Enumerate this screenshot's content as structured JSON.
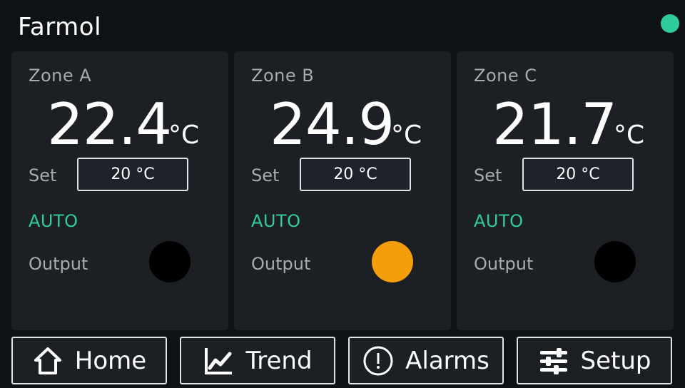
{
  "header": {
    "title": "Farmol",
    "status_color": "#2ecc9a"
  },
  "colors": {
    "accent": "#2ecc9a",
    "output_on": "#f59e0b",
    "output_off": "#000000"
  },
  "zones": [
    {
      "name": "Zone A",
      "temperature": "22.4",
      "unit": "°C",
      "set_label": "Set",
      "setpoint": "20 °C",
      "mode": "AUTO",
      "output_label": "Output",
      "output_on": false
    },
    {
      "name": "Zone B",
      "temperature": "24.9",
      "unit": "°C",
      "set_label": "Set",
      "setpoint": "20 °C",
      "mode": "AUTO",
      "output_label": "Output",
      "output_on": true
    },
    {
      "name": "Zone C",
      "temperature": "21.7",
      "unit": "°C",
      "set_label": "Set",
      "setpoint": "20 °C",
      "mode": "AUTO",
      "output_label": "Output",
      "output_on": false
    }
  ],
  "nav": [
    {
      "label": "Home",
      "icon": "home-icon"
    },
    {
      "label": "Trend",
      "icon": "trend-chart-icon"
    },
    {
      "label": "Alarms",
      "icon": "alert-circle-icon"
    },
    {
      "label": "Setup",
      "icon": "sliders-icon"
    }
  ]
}
